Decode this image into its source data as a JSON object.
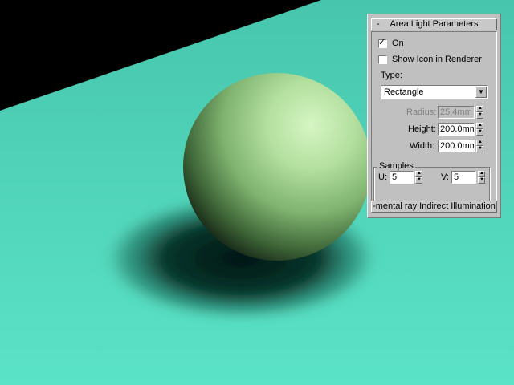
{
  "scene": {
    "floor_color": "#55dcbf",
    "sphere_color": "#b9e3a6",
    "background_color": "#000000"
  },
  "panel": {
    "rollout_toggle": "-",
    "rollout_title": "Area Light Parameters",
    "on": {
      "label": "On",
      "checked": true,
      "mark": "✓"
    },
    "show_icon": {
      "label": "Show Icon in Renderer",
      "checked": false,
      "mark": ""
    },
    "type_label": "Type:",
    "type_value": "Rectangle",
    "type_arrow": "▼",
    "radius": {
      "label": "Radius:",
      "value": "25.4mm",
      "enabled": false
    },
    "height": {
      "label": "Height:",
      "value": "200.0mm"
    },
    "width": {
      "label": "Width:",
      "value": "200.0mm"
    },
    "samples": {
      "label": "Samples",
      "u_label": "U:",
      "u_value": "5",
      "v_label": "V:",
      "v_value": "5"
    },
    "spinner_up": "▲",
    "spinner_down": "▼",
    "next_rollout": "-mental ray Indirect Illumination"
  }
}
